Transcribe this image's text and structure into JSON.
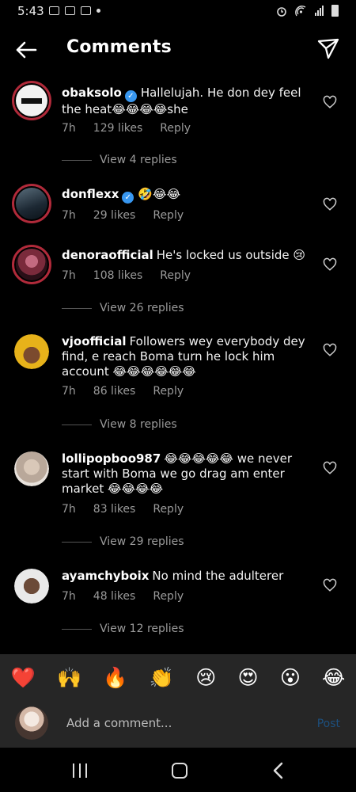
{
  "status_bar": {
    "time": "5:43"
  },
  "header": {
    "title": "Comments"
  },
  "comments": [
    {
      "username": "obaksolo",
      "verified": true,
      "text": "Hallelujah. He don dey feel the heat😂😂😂😂she",
      "time": "7h",
      "likes": "129 likes",
      "reply": "Reply",
      "view_replies": "View 4 replies",
      "avatar_desc": "logo"
    },
    {
      "username": "donflexx",
      "verified": true,
      "text": "🤣😂😂",
      "time": "7h",
      "likes": "29 likes",
      "reply": "Reply"
    },
    {
      "username": "denoraofficial",
      "verified": false,
      "text": "He's locked us outside 😢",
      "time": "7h",
      "likes": "108 likes",
      "reply": "Reply",
      "view_replies": "View 26 replies"
    },
    {
      "username": "vjoofficial",
      "verified": false,
      "text": "Followers wey everybody dey find, e reach Boma turn he lock him account 😂😂😂😂😂😂",
      "time": "7h",
      "likes": "86 likes",
      "reply": "Reply",
      "view_replies": "View 8 replies"
    },
    {
      "username": "lollipopboo987",
      "verified": false,
      "text": "😂😂😂😂😂 we never start with Boma we go drag am enter market 😂😂😂😂",
      "time": "7h",
      "likes": "83 likes",
      "reply": "Reply",
      "view_replies": "View 29 replies"
    },
    {
      "username": "ayamchyboix",
      "verified": false,
      "text": "No mind the adulterer",
      "time": "7h",
      "likes": "48 likes",
      "reply": "Reply",
      "view_replies": "View 12 replies"
    }
  ],
  "emoji_bar": [
    "❤️",
    "🙌",
    "🔥",
    "👏",
    "😢",
    "😍",
    "😮",
    "😂"
  ],
  "composer": {
    "placeholder": "Add a comment...",
    "post_label": "Post"
  },
  "colors": {
    "verified": "#3897f0",
    "story_ring": "#b02a3a",
    "post": "#1d4f7d",
    "bar_bg": "#262626"
  },
  "icons": {
    "back": "arrow-left-icon",
    "send": "paper-plane-icon",
    "like": "heart-outline-icon"
  }
}
